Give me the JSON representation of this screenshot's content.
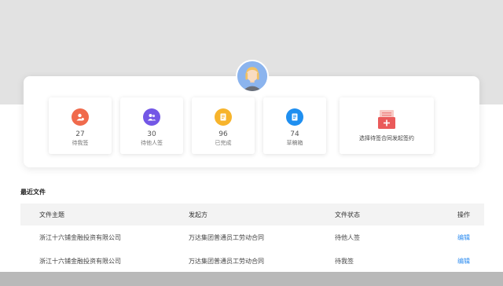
{
  "stats": [
    {
      "count": "27",
      "label": "待我签",
      "color": "#f06a4c",
      "icon": "user-sign-icon"
    },
    {
      "count": "30",
      "label": "待他人签",
      "color": "#7357e6",
      "icon": "users-icon"
    },
    {
      "count": "96",
      "label": "已完成",
      "color": "#f7b42c",
      "icon": "document-check-icon"
    },
    {
      "count": "74",
      "label": "草稿箱",
      "color": "#1f8ff0",
      "icon": "draft-icon"
    }
  ],
  "new_contract": {
    "label": "选择待签合同发起签约",
    "icon": "contract-add-icon",
    "color": "#ea5a5a"
  },
  "recent": {
    "title": "最近文件",
    "columns": [
      "文件主题",
      "发起方",
      "文件状态",
      "操作"
    ],
    "rows": [
      {
        "subject": "浙江十六铺金融投资有限公司",
        "initiator": "万达集团普通员工劳动合同",
        "status": "待他人签",
        "action": "编辑"
      },
      {
        "subject": "浙江十六铺金融投资有限公司",
        "initiator": "万达集团普通员工劳动合同",
        "status": "待我签",
        "action": "编辑"
      }
    ]
  },
  "colors": {
    "accent": "#2d8cf0",
    "header_bg": "#e2e2e2",
    "avatar_bg": "#8bb4ee"
  }
}
